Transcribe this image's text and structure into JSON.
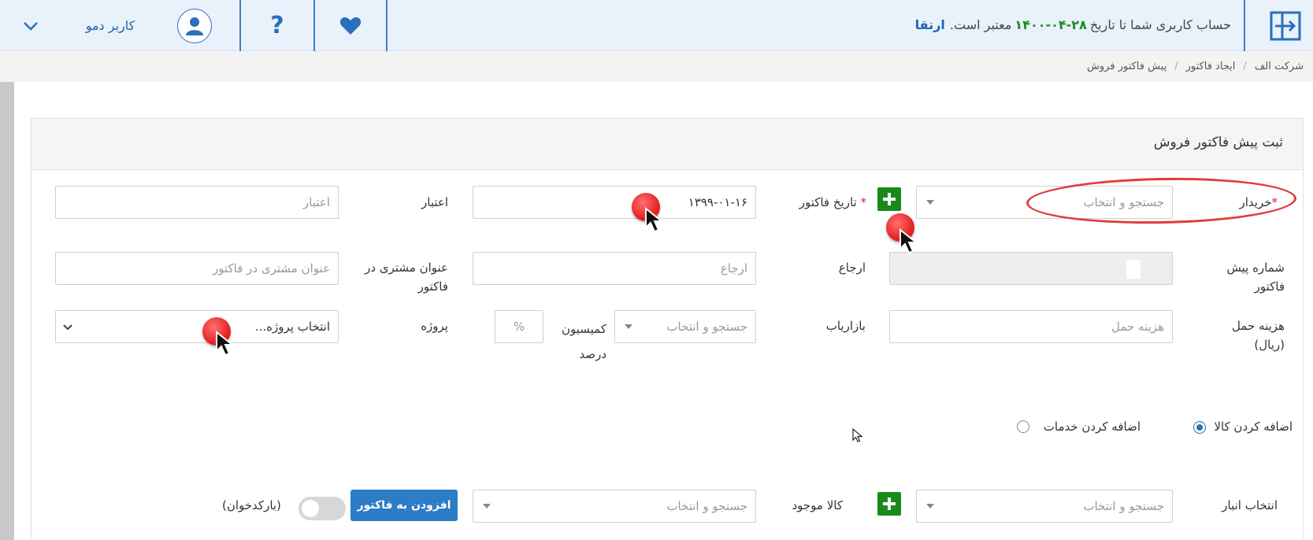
{
  "topbar": {
    "notice_prefix": "حساب کاربری شما تا تاریخ",
    "notice_date": "۱۴۰۰-۰۴-۲۸",
    "notice_suffix": "معتبر است.",
    "upgrade_link": "ارتقا",
    "username": "کاربر دمو",
    "icons": [
      "exit-icon",
      "heart-icon",
      "help-icon",
      "user-icon",
      "chevron-down-icon"
    ],
    "accent_color": "#2a6fbd"
  },
  "breadcrumb": [
    "شرکت الف",
    "ایجاد فاکتور",
    "پیش فاکتور فروش"
  ],
  "panel": {
    "title": "ثبت پیش فاکتور فروش"
  },
  "form": {
    "buyer_label": "خریدار",
    "buyer_placeholder": "جستجو و انتخاب",
    "invoice_date_label": "تاریخ فاکتور",
    "invoice_date_value": "۱۳۹۹-۰۱-۱۶",
    "credit_label": "اعتبار",
    "credit_placeholder": "اعتبار",
    "preinvoice_no_label": "شماره پیش فاکتور",
    "reference_label": "ارجاع",
    "reference_placeholder": "ارجاع",
    "customer_title_label": "عنوان مشتری در فاکتور",
    "customer_title_placeholder": "عنوان مشتری در فاکتور",
    "shipping_label": "هزینه حمل (ریال)",
    "shipping_placeholder": "هزینه حمل",
    "marketer_label": "بازاریاب",
    "marketer_placeholder": "جستجو و انتخاب",
    "commission_label": "کمیسیون درصد",
    "commission_unit": "%",
    "project_label": "پروژه",
    "project_value": "انتخاب پروژه..."
  },
  "item_type": {
    "goods_label": "اضافه کردن کالا",
    "services_label": "اضافه کردن خدمات",
    "selected": "goods"
  },
  "add_row": {
    "warehouse_label": "انتخاب انبار",
    "warehouse_placeholder": "جستجو و انتخاب",
    "stock_label": "کالا موجود",
    "stock_placeholder": "جستجو و انتخاب",
    "add_button": "افزودن به فاکتور",
    "barcode_label": "(بارکدخوان)",
    "barcode_enabled": false
  }
}
